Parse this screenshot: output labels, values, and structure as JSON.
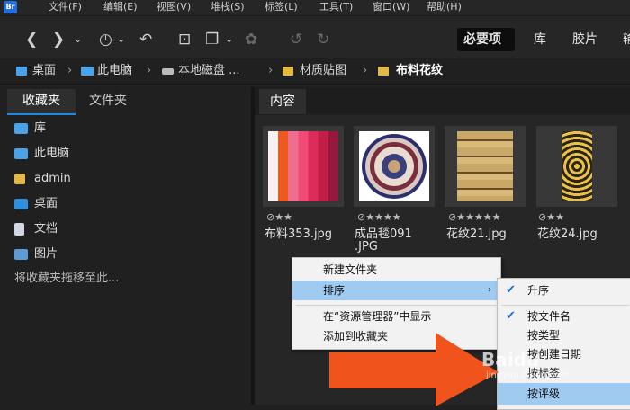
{
  "app": {
    "logo_text": "Br"
  },
  "menubar": [
    "文件(F)",
    "编辑(E)",
    "视图(V)",
    "堆栈(S)",
    "标签(L)",
    "工具(T)",
    "窗口(W)",
    "帮助(H)"
  ],
  "workspaces": {
    "items": [
      "必要项",
      "库",
      "胶片",
      "输"
    ],
    "active": "必要项"
  },
  "breadcrumb": [
    "桌面",
    "此电脑",
    "本地磁盘 ...",
    "材质贴图",
    "布料花纹"
  ],
  "left_panel": {
    "tabs": [
      "收藏夹",
      "文件夹"
    ],
    "favorites": [
      "库",
      "此电脑",
      "admin",
      "桌面",
      "文档",
      "图片"
    ],
    "hint": "将收藏夹拖移至此..."
  },
  "content": {
    "tab": "内容",
    "thumbnails": [
      {
        "name": "布料353.jpg",
        "stars": 2,
        "rating_text": "⊘★★"
      },
      {
        "name": "成品毯091\n.JPG",
        "name_line1": "成品毯091",
        "name_line2": ".JPG",
        "stars": 4,
        "rating_text": "⊘★★★★"
      },
      {
        "name": "花纹21.jpg",
        "stars": 5,
        "rating_text": "⊘★★★★★"
      },
      {
        "name": "花纹24.jpg",
        "stars": 2,
        "rating_text": "⊘★★"
      }
    ]
  },
  "context_menu": {
    "items": [
      "新建文件夹",
      "排序",
      "在“资源管理器”中显示",
      "添加到收藏夹"
    ],
    "active": "排序",
    "arrow": "›"
  },
  "sort_submenu": {
    "items": [
      {
        "label": "升序",
        "checked": true
      },
      {
        "label": "按文件名",
        "checked": true
      },
      {
        "label": "按类型",
        "checked": false
      },
      {
        "label": "按创建日期",
        "checked": false
      },
      {
        "label": "按标签",
        "checked": false
      },
      {
        "label": "按评级",
        "checked": false,
        "highlighted": true
      }
    ],
    "check_glyph": "✔"
  },
  "overlay": {
    "watermark": "Baidu",
    "watermark_sub": "jingyan.baidu.com"
  },
  "colors": {
    "accent": "#1e88e5",
    "menu_highlight": "#9fcbf0",
    "arrow": "#f0541c",
    "folder": "#e2b84a"
  }
}
